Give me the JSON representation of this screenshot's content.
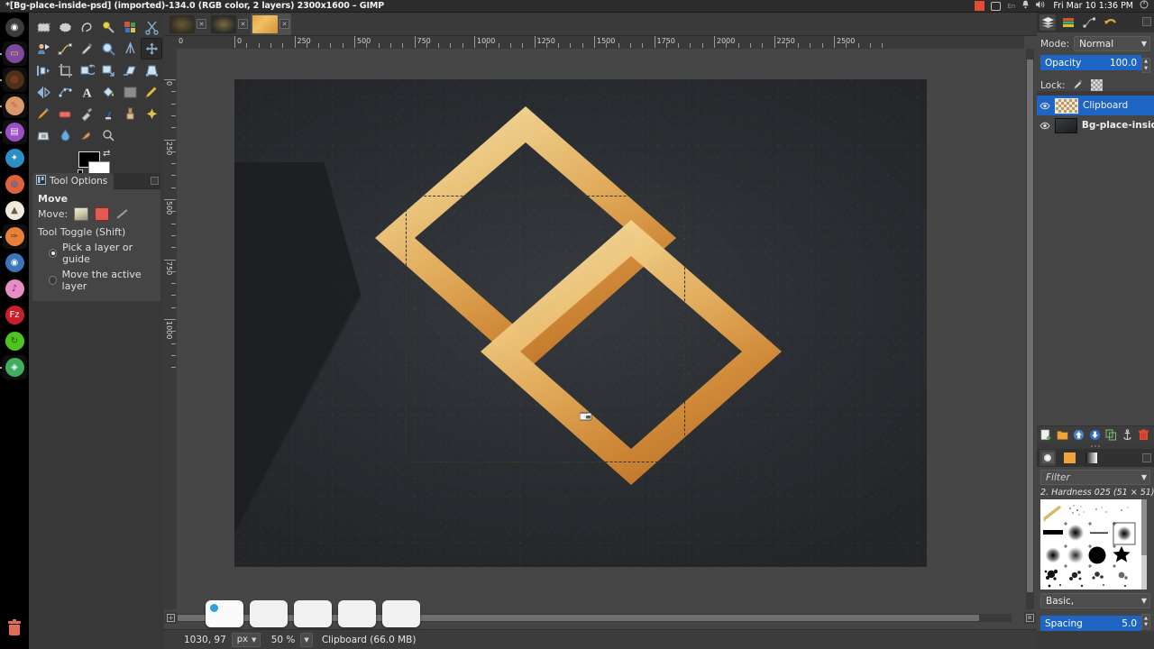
{
  "window": {
    "title": "*[Bg-place-inside-psd] (imported)-134.0 (RGB color, 2 layers) 2300x1600 – GIMP"
  },
  "systray": {
    "keyboard_layout": "En",
    "clock": "Fri Mar 10  1:36 PM",
    "icons": [
      "recording-indicator-icon",
      "display-icon",
      "keyboard-layout-icon",
      "bell-icon",
      "volume-icon",
      "power-icon"
    ]
  },
  "dock": {
    "items": [
      {
        "name": "ubuntu-logo-icon",
        "color": "#3b3b3b",
        "glyph": "◉",
        "fg": "#ffffff",
        "running": false
      },
      {
        "name": "files-icon",
        "color": "#7d4a9e",
        "glyph": "▭",
        "fg": "#f0c24b",
        "running": true
      },
      {
        "name": "chrome-icon",
        "color": "#4a3118",
        "glyph": "◎",
        "fg": "#e8453c",
        "running": true
      },
      {
        "name": "text-editor-icon",
        "color": "#d89a6a",
        "glyph": "✎",
        "fg": "#e0534d",
        "running": true
      },
      {
        "name": "document-viewer-icon",
        "color": "#9b4fc4",
        "glyph": "▤",
        "fg": "#f2f2f2",
        "running": true
      },
      {
        "name": "office-suite-icon",
        "color": "#2b8fc4",
        "glyph": "✦",
        "fg": "#ffffff",
        "running": false
      },
      {
        "name": "firefox-icon",
        "color": "#e2613b",
        "glyph": "◍",
        "fg": "#2b6fb5",
        "running": false
      },
      {
        "name": "gimp-icon",
        "color": "#efeadb",
        "glyph": "▲",
        "fg": "#6b5b3e",
        "running": false
      },
      {
        "name": "inkscape-icon",
        "color": "#e8803a",
        "glyph": "✑",
        "fg": "#5a3a18",
        "running": true
      },
      {
        "name": "shutter-icon",
        "color": "#3c74b8",
        "glyph": "◉",
        "fg": "#f2f2f2",
        "running": false
      },
      {
        "name": "music-icon",
        "color": "#e88ec4",
        "glyph": "♪",
        "fg": "#7a2a5a",
        "running": false
      },
      {
        "name": "filezilla-icon",
        "color": "#c91f2a",
        "glyph": "Fz",
        "fg": "#ffffff",
        "running": false
      },
      {
        "name": "teamviewer-icon",
        "color": "#4ec421",
        "glyph": "↻",
        "fg": "#1f5a10",
        "running": false
      },
      {
        "name": "software-center-icon",
        "color": "#3fae5e",
        "glyph": "◈",
        "fg": "#eaf6ff",
        "running": true
      }
    ],
    "trash": "trash-icon"
  },
  "toolbox": {
    "tools": [
      {
        "name": "rect-select-tool",
        "selected": false
      },
      {
        "name": "ellipse-select-tool",
        "selected": false
      },
      {
        "name": "free-select-tool",
        "selected": false
      },
      {
        "name": "fuzzy-select-tool",
        "selected": false
      },
      {
        "name": "select-by-color-tool",
        "selected": false
      },
      {
        "name": "scissors-select-tool",
        "selected": false
      },
      {
        "name": "foreground-select-tool",
        "selected": false
      },
      {
        "name": "paths-tool",
        "selected": false
      },
      {
        "name": "color-picker-tool",
        "selected": false
      },
      {
        "name": "zoom-tool",
        "selected": false
      },
      {
        "name": "measure-tool",
        "selected": false
      },
      {
        "name": "move-tool",
        "selected": true
      },
      {
        "name": "align-tool",
        "selected": false
      },
      {
        "name": "crop-tool",
        "selected": false
      },
      {
        "name": "rotate-tool",
        "selected": false
      },
      {
        "name": "scale-tool",
        "selected": false
      },
      {
        "name": "shear-tool",
        "selected": false
      },
      {
        "name": "perspective-tool",
        "selected": false
      },
      {
        "name": "flip-tool",
        "selected": false
      },
      {
        "name": "cage-transform-tool",
        "selected": false
      },
      {
        "name": "text-tool",
        "selected": false
      },
      {
        "name": "bucket-fill-tool",
        "selected": false
      },
      {
        "name": "gradient-tool",
        "selected": false
      },
      {
        "name": "pencil-tool",
        "selected": false
      },
      {
        "name": "paintbrush-tool",
        "selected": false
      },
      {
        "name": "eraser-tool",
        "selected": false
      },
      {
        "name": "airbrush-tool",
        "selected": false
      },
      {
        "name": "ink-tool",
        "selected": false
      },
      {
        "name": "clone-tool",
        "selected": false
      },
      {
        "name": "heal-tool",
        "selected": false
      },
      {
        "name": "perspective-clone-tool",
        "selected": false
      },
      {
        "name": "blur-sharpen-tool",
        "selected": false
      },
      {
        "name": "smudge-tool",
        "selected": false
      },
      {
        "name": "dodge-burn-tool",
        "selected": false
      }
    ],
    "foreground_color": "#000000",
    "background_color": "#ffffff"
  },
  "tool_options": {
    "tab_label": "Tool Options",
    "title": "Move",
    "move_label": "Move:",
    "move_modes": [
      "move-layer-icon",
      "move-selection-icon",
      "move-path-icon"
    ],
    "toggle_label": "Tool Toggle  (Shift)",
    "options": [
      {
        "label": "Pick a layer or guide",
        "selected": true
      },
      {
        "label": "Move the active layer",
        "selected": false
      }
    ]
  },
  "image_tabs": [
    {
      "name": "image-tab-1",
      "active": false
    },
    {
      "name": "image-tab-2",
      "active": false
    },
    {
      "name": "image-tab-3",
      "active": true
    }
  ],
  "rulers": {
    "unit": "px",
    "horizontal_labels": [
      "0",
      "0",
      "250",
      "500",
      "750",
      "1000",
      "1250",
      "1500",
      "1750",
      "2000",
      "2250",
      "2500"
    ],
    "vertical_labels": [
      "0",
      "250",
      "500",
      "750",
      "1000"
    ]
  },
  "canvas": {
    "selection_active": true,
    "cursor": "move-cursor",
    "artwork_description": "gold interlocking diamond logo on dark textured paper"
  },
  "statusbar": {
    "position": "1030, 97",
    "unit": "px",
    "zoom": "50 %",
    "message": "Clipboard (66.0 MB)"
  },
  "workspace_strip": {
    "items": [
      {
        "name": "workspace-thumb-1",
        "active": true
      },
      {
        "name": "workspace-thumb-2",
        "active": false
      },
      {
        "name": "workspace-thumb-3",
        "active": false
      },
      {
        "name": "workspace-thumb-4",
        "active": false
      },
      {
        "name": "workspace-thumb-5",
        "active": false
      }
    ]
  },
  "layers_dock": {
    "tabs": [
      {
        "name": "tab-layers",
        "icon": "layers-icon",
        "selected": true
      },
      {
        "name": "tab-channels",
        "icon": "channels-icon",
        "selected": false
      },
      {
        "name": "tab-paths",
        "icon": "paths-icon",
        "selected": false
      },
      {
        "name": "tab-undo-history",
        "icon": "undo-history-icon",
        "selected": false
      }
    ],
    "mode_label": "Mode:",
    "mode_value": "Normal",
    "opacity_label": "Opacity",
    "opacity_value": "100.0",
    "lock_label": "Lock:",
    "lock_icons": [
      "lock-pixels-icon",
      "lock-alpha-icon"
    ],
    "layers": [
      {
        "name": "Clipboard",
        "selected": true,
        "visible": true,
        "bold": false
      },
      {
        "name": "Bg-place-insid",
        "selected": false,
        "visible": true,
        "bold": true
      }
    ],
    "buttons": [
      {
        "name": "new-layer-button",
        "icon": "new-layer-icon"
      },
      {
        "name": "new-layer-group-button",
        "icon": "folder-icon"
      },
      {
        "name": "raise-layer-button",
        "icon": "arrow-up-icon"
      },
      {
        "name": "lower-layer-button",
        "icon": "arrow-down-icon"
      },
      {
        "name": "duplicate-layer-button",
        "icon": "duplicate-icon"
      },
      {
        "name": "anchor-layer-button",
        "icon": "anchor-icon"
      },
      {
        "name": "delete-layer-button",
        "icon": "trash-icon"
      }
    ]
  },
  "brushes_dock": {
    "tabs": [
      {
        "name": "tab-brushes",
        "icon": "brush-icon",
        "selected": true
      },
      {
        "name": "tab-patterns",
        "icon": "pattern-icon",
        "selected": false
      },
      {
        "name": "tab-gradients",
        "icon": "gradient-icon",
        "selected": false
      }
    ],
    "filter_placeholder": "Filter",
    "selected_brush": "2. Hardness 025 (51 × 51)",
    "preset_label": "Basic,",
    "spacing_label": "Spacing",
    "spacing_value": "5.0"
  },
  "colors": {
    "accent_blue": "#1e65c4",
    "panel_bg": "#454545",
    "dock_bg": "#3a3a3a",
    "selection_yellow": "#d9d97a",
    "gold_light": "#f3d08a",
    "gold_mid": "#e0a849",
    "gold_dark": "#c2762b"
  }
}
